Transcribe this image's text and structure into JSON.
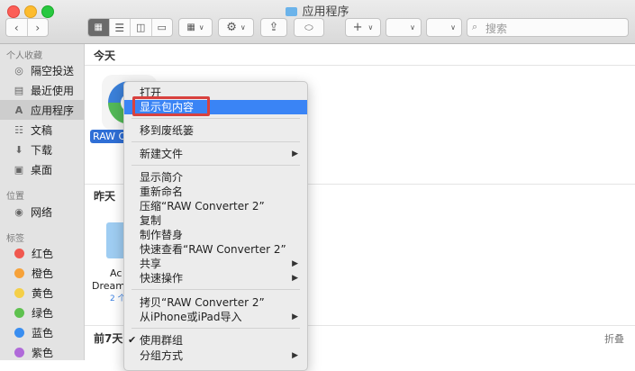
{
  "window": {
    "title": "应用程序"
  },
  "toolbar": {
    "search_placeholder": "搜索"
  },
  "sidebar": {
    "favorites_header": "个人收藏",
    "favorites": [
      {
        "label": "隔空投送",
        "icon": "airdrop-icon"
      },
      {
        "label": "最近使用",
        "icon": "recents-icon"
      },
      {
        "label": "应用程序",
        "icon": "applications-icon",
        "selected": true
      },
      {
        "label": "文稿",
        "icon": "documents-icon"
      },
      {
        "label": "下载",
        "icon": "downloads-icon"
      },
      {
        "label": "桌面",
        "icon": "desktop-icon"
      }
    ],
    "locations_header": "位置",
    "locations": [
      {
        "label": "网络",
        "icon": "network-icon"
      }
    ],
    "tags_header": "标签",
    "tags": [
      {
        "label": "红色",
        "color": "#f0584f"
      },
      {
        "label": "橙色",
        "color": "#f6a23a"
      },
      {
        "label": "黄色",
        "color": "#f4cf48"
      },
      {
        "label": "绿色",
        "color": "#5ec14f"
      },
      {
        "label": "蓝色",
        "color": "#3a8ef0"
      },
      {
        "label": "紫色",
        "color": "#b06ad9"
      }
    ]
  },
  "main": {
    "groups": {
      "today": "今天",
      "yesterday": "昨天",
      "last7": "前7天",
      "collapse": "折叠"
    },
    "files": {
      "raw_label": "RAW Co",
      "dream_line1": "Ac",
      "dream_line2": "Dreamw",
      "dream_line3": "2 个"
    }
  },
  "context_menu": {
    "open": "打开",
    "show_package": "显示包内容",
    "trash": "移到废纸篓",
    "new_folder": "新建文件",
    "get_info": "显示简介",
    "rename": "重新命名",
    "compress": "压缩“RAW Converter 2”",
    "duplicate": "复制",
    "alias": "制作替身",
    "quicklook": "快速查看“RAW Converter 2”",
    "share": "共享",
    "quick_actions": "快速操作",
    "copy": "拷贝“RAW Converter 2”",
    "import_iphone": "从iPhone或iPad导入",
    "use_groups": "使用群组",
    "group_by": "分组方式"
  },
  "colors": {
    "highlight": "#3a84f5",
    "annotation_red": "#d8413e"
  }
}
